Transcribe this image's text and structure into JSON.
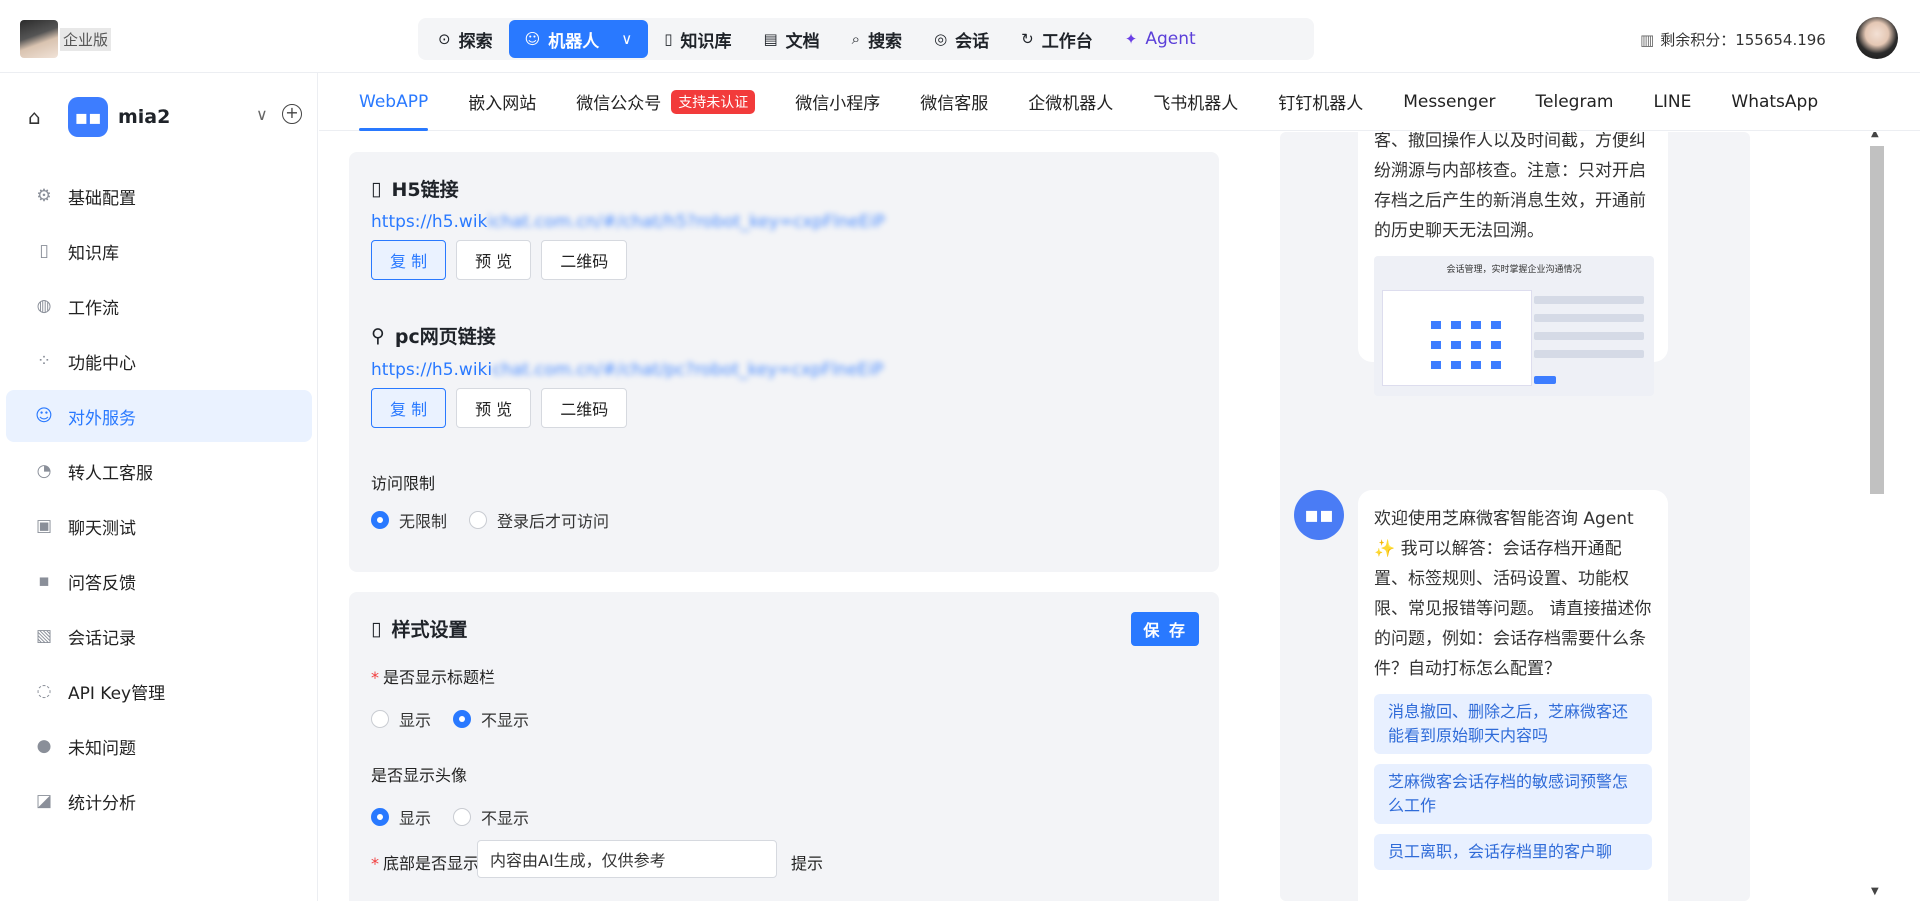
{
  "header": {
    "edition_label": "企业版",
    "nav": [
      {
        "label": "探索",
        "icon": "planet-icon"
      },
      {
        "label": "机器人",
        "icon": "robot-icon",
        "active": true
      },
      {
        "label": "知识库",
        "icon": "book-icon"
      },
      {
        "label": "文档",
        "icon": "document-icon"
      },
      {
        "label": "搜索",
        "icon": "search-icon"
      },
      {
        "label": "会话",
        "icon": "chat-icon"
      },
      {
        "label": "工作台",
        "icon": "refresh-icon"
      },
      {
        "label": "Agent",
        "icon": "sparkle-icon"
      }
    ],
    "credits_label": "剩余积分：155654.196"
  },
  "sidebar": {
    "bot_name": "mia2",
    "items": [
      {
        "label": "基础配置",
        "icon": "gear-icon"
      },
      {
        "label": "知识库",
        "icon": "book-icon"
      },
      {
        "label": "工作流",
        "icon": "workflow-icon"
      },
      {
        "label": "功能中心",
        "icon": "grid-icon"
      },
      {
        "label": "对外服务",
        "icon": "service-icon",
        "active": true
      },
      {
        "label": "转人工客服",
        "icon": "agent-icon"
      },
      {
        "label": "聊天测试",
        "icon": "test-icon"
      },
      {
        "label": "问答反馈",
        "icon": "feedback-icon"
      },
      {
        "label": "会话记录",
        "icon": "record-icon"
      },
      {
        "label": "API Key管理",
        "icon": "key-icon"
      },
      {
        "label": "未知问题",
        "icon": "question-icon"
      },
      {
        "label": "统计分析",
        "icon": "chart-icon"
      }
    ]
  },
  "tabs": [
    {
      "label": "WebAPP",
      "active": true
    },
    {
      "label": "嵌入网站"
    },
    {
      "label": "微信公众号",
      "badge": "支持未认证"
    },
    {
      "label": "微信小程序"
    },
    {
      "label": "微信客服"
    },
    {
      "label": "企微机器人"
    },
    {
      "label": "飞书机器人"
    },
    {
      "label": "钉钉机器人"
    },
    {
      "label": "Messenger"
    },
    {
      "label": "Telegram"
    },
    {
      "label": "LINE"
    },
    {
      "label": "WhatsApp"
    }
  ],
  "h5": {
    "title": "H5链接",
    "link_visible": "https://h5.wik",
    "link_blurred": "ichat.com.cn/#/chat/h5?robot_key=cxpFlneEiP",
    "copy": "复 制",
    "preview": "预 览",
    "qrcode": "二维码"
  },
  "pc": {
    "title": "pc网页链接",
    "link_visible": "https://h5.wiki",
    "link_blurred": "chat.com.cn/#/chat/pc?robot_key=cxpFlneEiP",
    "copy": "复 制",
    "preview": "预 览",
    "qrcode": "二维码"
  },
  "access": {
    "label": "访问限制",
    "options": [
      "无限制",
      "登录后才可访问"
    ],
    "selected": 0
  },
  "style": {
    "title": "样式设置",
    "save": "保 存",
    "show_title_label": "是否显示标题栏",
    "show_title_options": [
      "显示",
      "不显示"
    ],
    "show_title_selected": 1,
    "show_avatar_label": "是否显示头像",
    "show_avatar_options": [
      "显示",
      "不显示"
    ],
    "show_avatar_selected": 0,
    "footer_label": "底部是否显示",
    "footer_value": "内容由AI生成，仅供参考",
    "footer_suffix": "提示"
  },
  "chat": {
    "msg1_text": "客、撤回操作人以及时间截，方便纠纷溯源与内部核查。注意：只对开启存档之后产生的新消息生效，开通前的历史聊天无法回溯。",
    "msg1_image_title": "会话管理，实时掌握企业沟通情况",
    "msg2_text": "欢迎使用芝麻微客智能咨询 Agent ✨ 我可以解答：会话存档开通配置、标签规则、活码设置、功能权限、常见报错等问题。 请直接描述你的问题，例如：会话存档需要什么条件？自动打标怎么配置？",
    "suggestions": [
      "消息撤回、删除之后，芝麻微客还能看到原始聊天内容吗",
      "芝麻微客会话存档的敏感词预警怎么工作",
      "员工离职，会话存档里的客户聊"
    ]
  }
}
